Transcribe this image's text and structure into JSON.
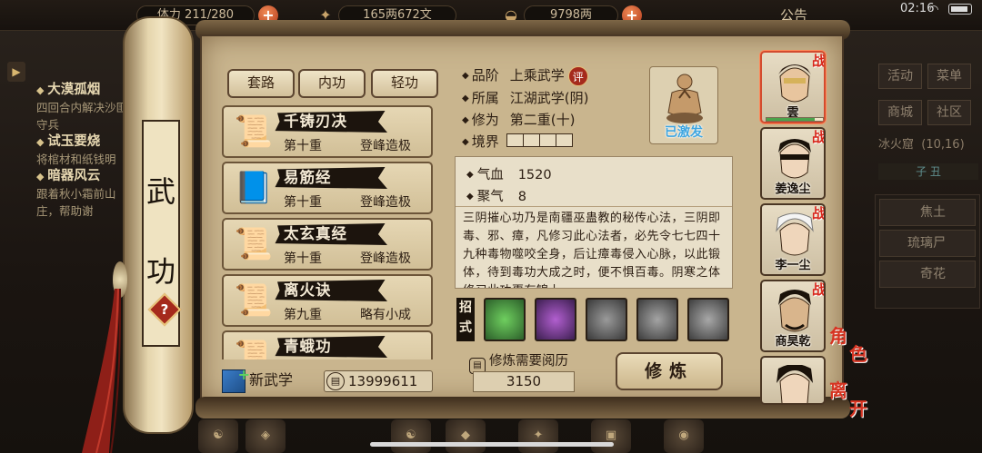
{
  "topbar": {
    "res1": "体力 211/280",
    "res2": "165两672文",
    "res3": "9798两",
    "notice": "公告",
    "time": "02:16"
  },
  "quests": [
    {
      "title": "大漠孤烟",
      "desc": "四回合内解决沙匪守兵"
    },
    {
      "title": "试玉要烧",
      "desc": "将棺材和纸钱明"
    },
    {
      "title": "暗器风云",
      "desc": "跟着秋小霜前山庄，帮助谢"
    }
  ],
  "side_panel": {
    "btn_activity": "活动",
    "btn_menu": "菜单",
    "btn_shop": "商城",
    "btn_community": "社区",
    "location": "冰火窟",
    "location_coords": "(10,16)",
    "time_slot": "子 丑",
    "items": [
      "焦土",
      "琉璃尸",
      "奇花"
    ]
  },
  "scroll_title": [
    "武",
    "功"
  ],
  "help_label": "?",
  "tabs": [
    "套路",
    "内功",
    "轻功"
  ],
  "skills": [
    {
      "name": "千铸刃决",
      "level": "第十重",
      "desc": "登峰造极",
      "icon": "scroll-icon"
    },
    {
      "name": "易筋经",
      "level": "第十重",
      "desc": "登峰造极",
      "icon": "book-icon"
    },
    {
      "name": "太玄真经",
      "level": "第十重",
      "desc": "登峰造极",
      "icon": "scroll-icon"
    },
    {
      "name": "离火诀",
      "level": "第九重",
      "desc": "略有小成",
      "icon": "scroll-icon"
    },
    {
      "name": "青蛾功",
      "level": "",
      "desc": "",
      "icon": "scroll-icon"
    }
  ],
  "new_skill_label": "新武学",
  "scroll_count": "13999611",
  "detail": {
    "grade_label": "品阶",
    "grade": "上乘武学",
    "grade_badge": "评",
    "belong_label": "所属",
    "belong": "江湖武学(阴)",
    "cultivation_label": "修为",
    "cultivation": "第二重(十)",
    "realm_label": "境界",
    "portrait_tag": "已激发",
    "hp_label": "气血",
    "hp": "1520",
    "focus_label": "聚气",
    "focus": "8",
    "description": "三阴摧心功乃是南疆巫蛊教的秘传心法，三阴即毒、邪、瘴，凡修习此心法者，必先令七七四十九种毒物噬咬全身，后让瘴毒侵入心脉，以此锻体，待到毒功大成之时，便不惧百毒。阴寒之体修习此功更有锦上"
  },
  "moves_label": "招式",
  "moves": [
    "move-1-icon",
    "move-2-icon",
    "move-3-icon",
    "move-4-icon",
    "move-5-icon"
  ],
  "cultivation_req_label": "修炼需要阅历",
  "cultivation_req": "3150",
  "train_button": "修炼",
  "characters": [
    {
      "name": "雲",
      "battle": "战",
      "hp": 0.85
    },
    {
      "name": "姜逸尘",
      "battle": "战"
    },
    {
      "name": "李一尘",
      "battle": "战"
    },
    {
      "name": "商昊乾",
      "battle": "战"
    },
    {
      "name": "",
      "battle": ""
    }
  ],
  "side_tab_role": [
    "角",
    "色"
  ],
  "side_tab_leave": [
    "离",
    "开"
  ]
}
